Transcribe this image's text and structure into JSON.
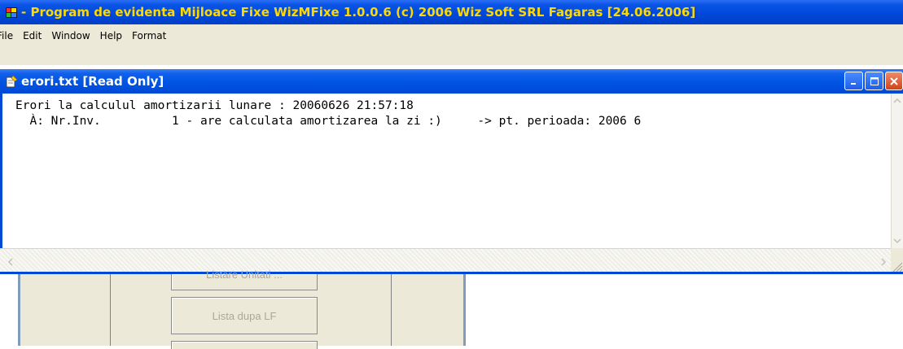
{
  "app": {
    "title": "- Program de evidenta Mijloace Fixe  WizMFixe 1.0.0.6 (c) 2006 Wiz Soft SRL Fagaras [24.06.2006]",
    "title_color": "#ffd800",
    "icon": "app-logo-icon"
  },
  "menu": {
    "items": [
      {
        "label": "File"
      },
      {
        "label": "Edit"
      },
      {
        "label": "Window"
      },
      {
        "label": "Help"
      },
      {
        "label": "Format"
      }
    ]
  },
  "child_window": {
    "title": "erori.txt [Read Only]",
    "icon": "notepad-icon",
    "buttons": {
      "minimize": "minimize-icon",
      "maximize": "maximize-icon",
      "close": "close-icon"
    },
    "content_lines": [
      "Erori la calculul amortizarii lunare : 20060626 21:57:18",
      "  À: Nr.Inv.          1 - are calculata amortizarea la zi :)     -> pt. perioada: 2006 6"
    ]
  },
  "background": {
    "buttons": [
      {
        "label": "Listare Unitati ..."
      },
      {
        "label": "Lista dupa LF"
      },
      {
        "label": ""
      }
    ]
  },
  "colors": {
    "titlebar_blue": "#0054e3",
    "menu_bg": "#ece9d8",
    "disabled_text": "#aca899"
  }
}
